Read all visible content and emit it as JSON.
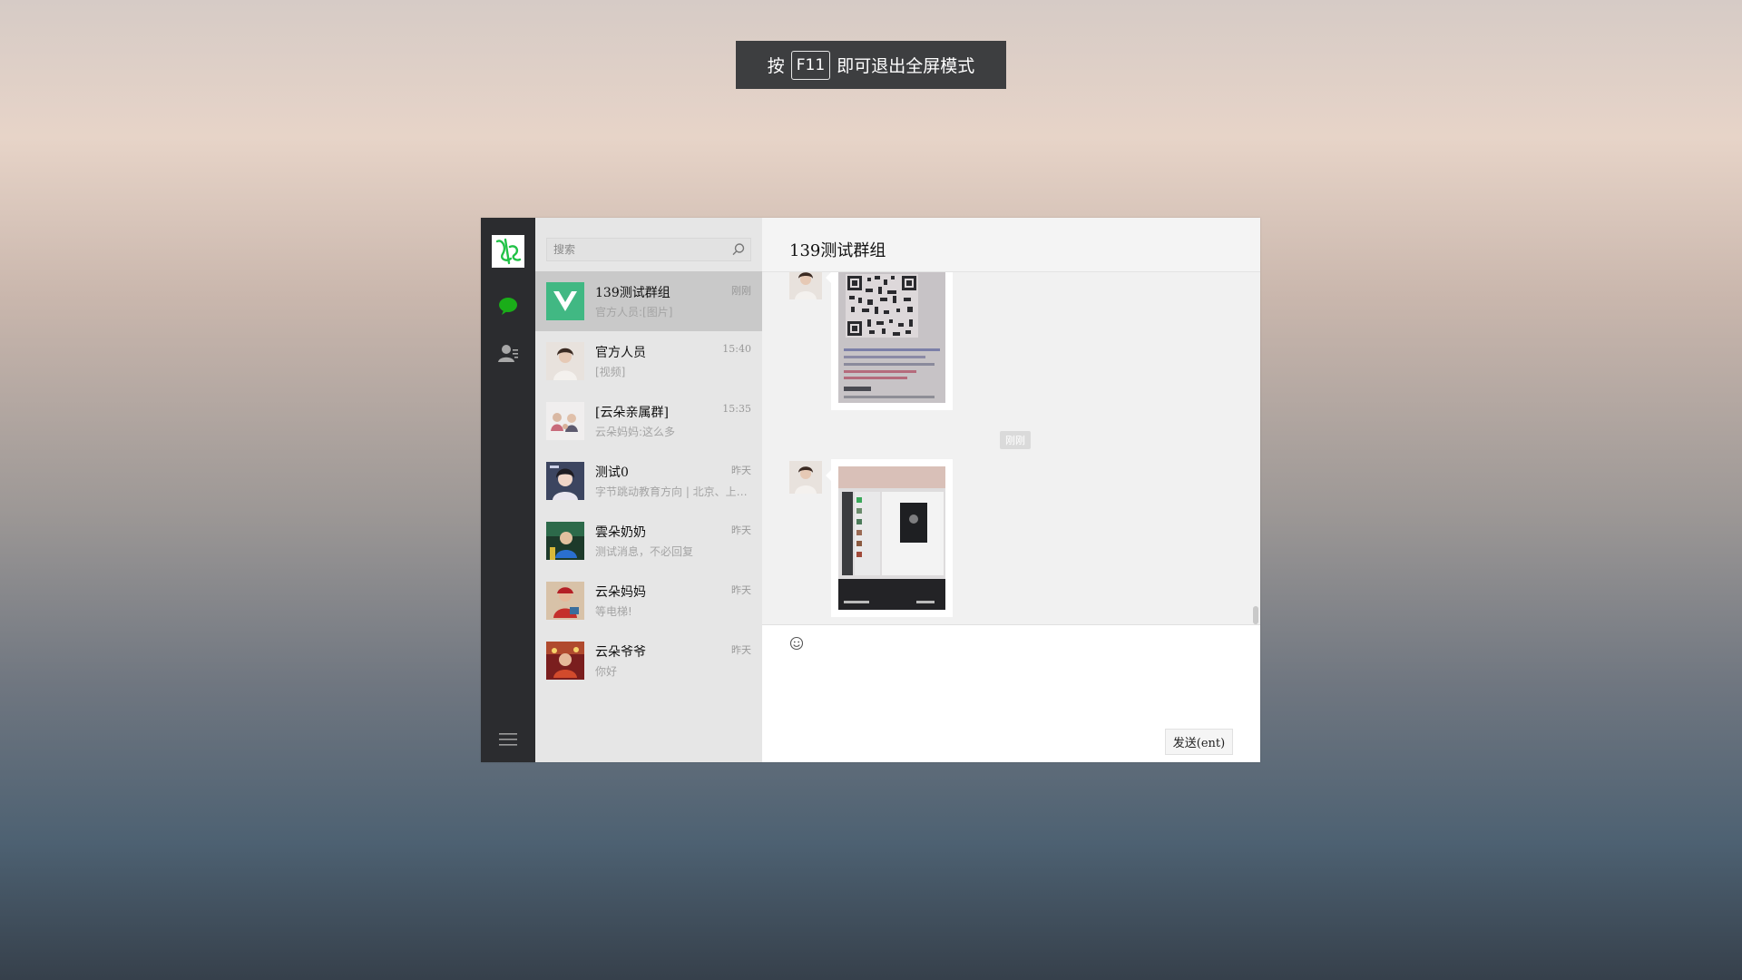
{
  "fullscreen_hint": {
    "prefix": "按",
    "key": "F11",
    "suffix": "即可退出全屏模式"
  },
  "search": {
    "placeholder": "搜索"
  },
  "chat": {
    "title": "139测试群组",
    "time_divider": "刚刚"
  },
  "conversations": [
    {
      "name": "139测试群组",
      "time": "刚刚",
      "preview": "官方人员:[图片]"
    },
    {
      "name": "官方人员",
      "time": "15:40",
      "preview": "[视频]"
    },
    {
      "name": "[云朵亲属群]",
      "time": "15:35",
      "preview": "云朵妈妈:这么多"
    },
    {
      "name": "测试0",
      "time": "昨天",
      "preview": "字节跳动教育方向 | 北京、上…"
    },
    {
      "name": "雲朵奶奶",
      "time": "昨天",
      "preview": "测试消息，不必回复"
    },
    {
      "name": "云朵妈妈",
      "time": "昨天",
      "preview": "等电梯!"
    },
    {
      "name": "云朵爷爷",
      "time": "昨天",
      "preview": "你好"
    }
  ],
  "composer": {
    "send_label": "发送(ent)"
  },
  "icons": [
    "user-avatar-icon",
    "chat-icon",
    "contacts-icon",
    "menu-icon",
    "search-icon",
    "emoji-icon"
  ],
  "colors": {
    "accent": "#1aad19",
    "rail": "#2b2c2f",
    "list_bg": "#e6e6e6",
    "active_item": "#c9c9c9"
  }
}
